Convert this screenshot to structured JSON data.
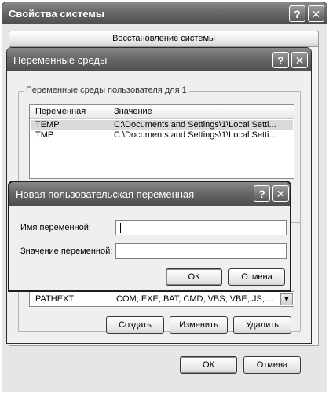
{
  "sysprops": {
    "title": "Свойства системы",
    "help_glyph": "?",
    "close_glyph": "✕",
    "tab_label": "Восстановление системы",
    "ok_label": "ОК",
    "cancel_label": "Отмена"
  },
  "envvars": {
    "title": "Переменные среды",
    "help_glyph": "?",
    "close_glyph": "✕",
    "user_group_label": "Переменные среды пользователя для 1",
    "columns": [
      "Переменная",
      "Значение"
    ],
    "user_rows": [
      {
        "name": "TEMP",
        "value": "C:\\Documents and Settings\\1\\Local Setti..."
      },
      {
        "name": "TMP",
        "value": "C:\\Documents and Settings\\1\\Local Setti..."
      }
    ],
    "system_rows_visible": [
      {
        "name": "PATHEXT",
        "value": ".COM;.EXE;.BAT;.CMD;.VBS;.VBE;.JS;...."
      }
    ],
    "create_label": "Создать",
    "edit_label": "Изменить",
    "delete_label": "Удалить",
    "scroll_down_glyph": "▼"
  },
  "newvar": {
    "title": "Новая пользовательская переменная",
    "help_glyph": "?",
    "close_glyph": "✕",
    "name_label": "Имя переменной:",
    "value_label": "Значение переменной:",
    "name_value": "",
    "value_value": "",
    "ok_label": "ОК",
    "cancel_label": "Отмена"
  }
}
